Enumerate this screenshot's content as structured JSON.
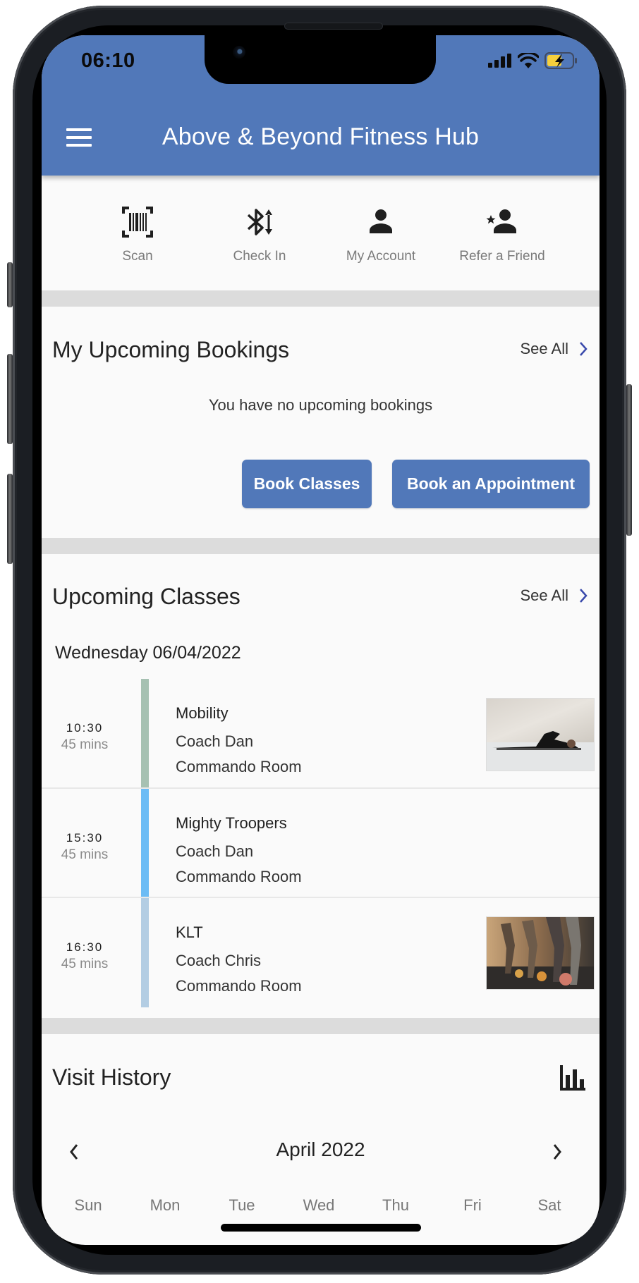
{
  "status_bar": {
    "time": "06:10",
    "icons": [
      "cellular-signal-icon",
      "wifi-icon",
      "battery-charging-icon"
    ],
    "battery_color": "#f5cf3c"
  },
  "header": {
    "title": "Above & Beyond Fitness Hub",
    "menu_icon": "hamburger-menu-icon",
    "background": "#5178b9"
  },
  "quick_actions": [
    {
      "label": "Scan",
      "icon": "barcode-scan-icon"
    },
    {
      "label": "Check In",
      "icon": "bluetooth-transfer-icon"
    },
    {
      "label": "My Account",
      "icon": "person-icon"
    },
    {
      "label": "Refer a Friend",
      "icon": "person-star-icon"
    }
  ],
  "bookings": {
    "title": "My Upcoming Bookings",
    "see_all": "See All",
    "empty_message": "You have no upcoming bookings",
    "buttons": {
      "book_classes": "Book Classes",
      "book_appointment": "Book an Appointment"
    }
  },
  "classes": {
    "title": "Upcoming Classes",
    "see_all": "See All",
    "date": "Wednesday 06/04/2022",
    "items": [
      {
        "time": "10:30",
        "duration": "45 mins",
        "name": "Mobility",
        "coach": "Coach Dan",
        "room": "Commando Room",
        "color": "#a6c1b2",
        "has_image": true,
        "image": "stretching-photo"
      },
      {
        "time": "15:30",
        "duration": "45 mins",
        "name": "Mighty Troopers",
        "coach": "Coach Dan",
        "room": "Commando Room",
        "color": "#6cbcf5",
        "has_image": false
      },
      {
        "time": "16:30",
        "duration": "45 mins",
        "name": "KLT",
        "coach": "Coach Chris",
        "room": "Commando Room",
        "color": "#b3cde3",
        "has_image": true,
        "image": "kettlebell-class-photo"
      }
    ]
  },
  "visit_history": {
    "title": "Visit History",
    "chart_icon": "bar-chart-icon",
    "month": "April 2022",
    "weekdays": [
      "Sun",
      "Mon",
      "Tue",
      "Wed",
      "Thu",
      "Fri",
      "Sat"
    ]
  },
  "colors": {
    "accent": "#5178b9",
    "chevron": "#3949ab",
    "divider": "#dcdcdc",
    "background": "#fafafa"
  }
}
